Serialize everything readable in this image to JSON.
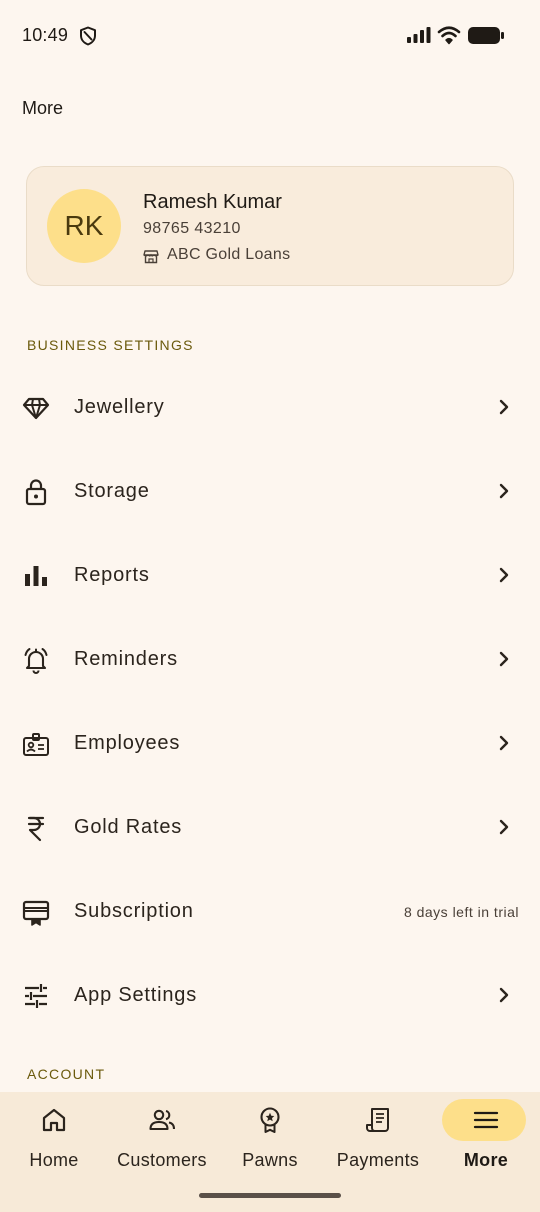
{
  "status_bar": {
    "time": "10:49"
  },
  "page_title": "More",
  "profile": {
    "initials": "RK",
    "name": "Ramesh Kumar",
    "phone": "98765 43210",
    "business": "ABC Gold Loans"
  },
  "sections": {
    "business_settings": "BUSINESS SETTINGS",
    "account": "ACCOUNT"
  },
  "menu": {
    "jewellery": {
      "label": "Jewellery",
      "icon": "diamond-icon"
    },
    "storage": {
      "label": "Storage",
      "icon": "lock-icon"
    },
    "reports": {
      "label": "Reports",
      "icon": "bar-chart-icon"
    },
    "reminders": {
      "label": "Reminders",
      "icon": "alarm-bell-icon"
    },
    "employees": {
      "label": "Employees",
      "icon": "id-badge-icon"
    },
    "gold_rates": {
      "label": "Gold Rates",
      "icon": "rupee-icon"
    },
    "subscription": {
      "label": "Subscription",
      "icon": "subscription-card-icon",
      "note": "8 days left in trial"
    },
    "app_settings": {
      "label": "App Settings",
      "icon": "sliders-icon"
    }
  },
  "bottom_nav": {
    "items": [
      {
        "label": "Home",
        "icon": "home-icon"
      },
      {
        "label": "Customers",
        "icon": "customers-icon"
      },
      {
        "label": "Pawns",
        "icon": "award-badge-icon"
      },
      {
        "label": "Payments",
        "icon": "receipt-icon"
      },
      {
        "label": "More",
        "icon": "menu-icon",
        "active": true
      }
    ]
  },
  "colors": {
    "background": "#fdf6ef",
    "card": "#f9ecdc",
    "accent": "#fddf8a",
    "section_header": "#6b5a0c",
    "nav_background": "#f7ead8"
  }
}
